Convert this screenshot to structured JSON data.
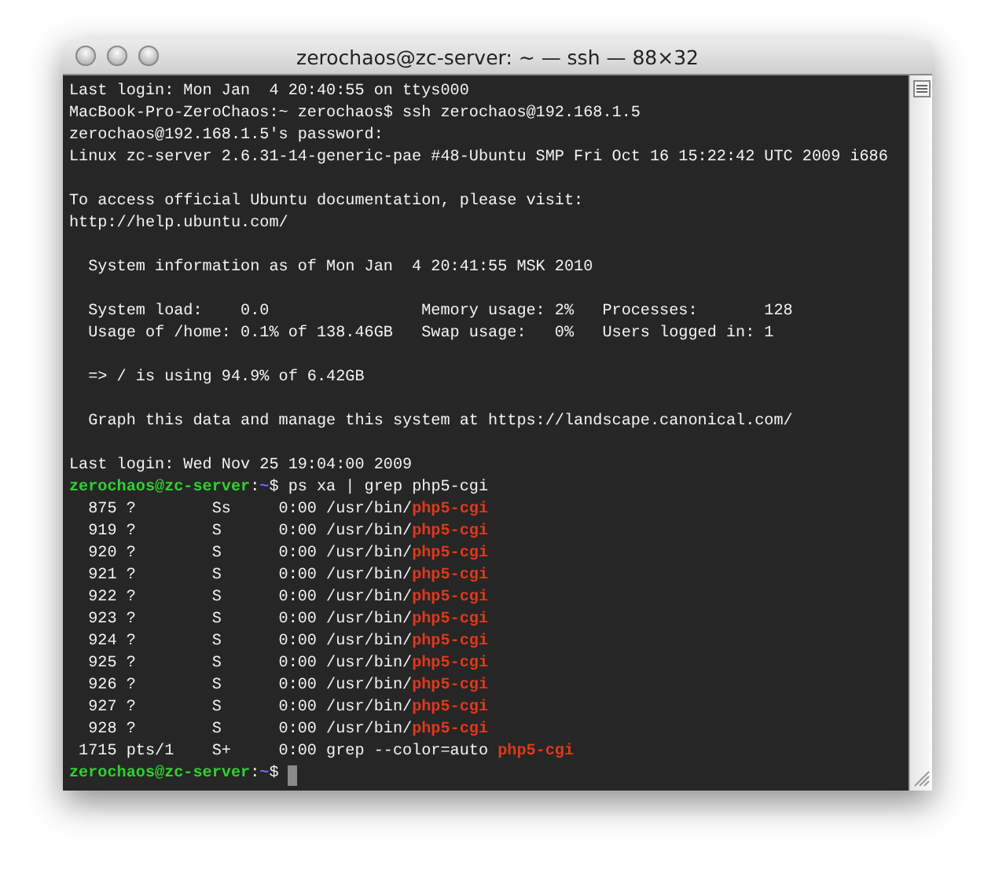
{
  "window": {
    "title": "zerochaos@zc-server: ~ — ssh — 88×32"
  },
  "terminal": {
    "lines": [
      {
        "kind": "text",
        "segments": [
          {
            "kind": "plain",
            "text": "Last login: Mon Jan  4 20:40:55 on ttys000"
          }
        ]
      },
      {
        "kind": "text",
        "segments": [
          {
            "kind": "plain",
            "text": "MacBook-Pro-ZeroChaos:~ zerochaos$ ssh zerochaos@192.168.1.5"
          }
        ]
      },
      {
        "kind": "text",
        "segments": [
          {
            "kind": "plain",
            "text": "zerochaos@192.168.1.5's password:"
          }
        ]
      },
      {
        "kind": "text",
        "segments": [
          {
            "kind": "plain",
            "text": "Linux zc-server 2.6.31-14-generic-pae #48-Ubuntu SMP Fri Oct 16 15:22:42 UTC 2009 i686"
          }
        ]
      },
      {
        "kind": "blank"
      },
      {
        "kind": "text",
        "segments": [
          {
            "kind": "plain",
            "text": "To access official Ubuntu documentation, please visit:"
          }
        ]
      },
      {
        "kind": "text",
        "segments": [
          {
            "kind": "plain",
            "text": "http://help.ubuntu.com/"
          }
        ]
      },
      {
        "kind": "blank"
      },
      {
        "kind": "text",
        "segments": [
          {
            "kind": "plain",
            "text": "  System information as of Mon Jan  4 20:41:55 MSK 2010"
          }
        ]
      },
      {
        "kind": "blank"
      },
      {
        "kind": "text",
        "segments": [
          {
            "kind": "plain",
            "text": "  System load:    0.0                Memory usage: 2%   Processes:       128"
          }
        ]
      },
      {
        "kind": "text",
        "segments": [
          {
            "kind": "plain",
            "text": "  Usage of /home: 0.1% of 138.46GB   Swap usage:   0%   Users logged in: 1"
          }
        ]
      },
      {
        "kind": "blank"
      },
      {
        "kind": "text",
        "segments": [
          {
            "kind": "plain",
            "text": "  => / is using 94.9% of 6.42GB"
          }
        ]
      },
      {
        "kind": "blank"
      },
      {
        "kind": "text",
        "segments": [
          {
            "kind": "plain",
            "text": "  Graph this data and manage this system at https://landscape.canonical.com/"
          }
        ]
      },
      {
        "kind": "blank"
      },
      {
        "kind": "text",
        "segments": [
          {
            "kind": "plain",
            "text": "Last login: Wed Nov 25 19:04:00 2009"
          }
        ]
      },
      {
        "kind": "text",
        "segments": [
          {
            "kind": "user",
            "text": "zerochaos@zc-server"
          },
          {
            "kind": "plain",
            "text": ":"
          },
          {
            "kind": "path",
            "text": "~"
          },
          {
            "kind": "plain",
            "text": "$ ps xa | grep php5-cgi"
          }
        ]
      },
      {
        "kind": "text",
        "segments": [
          {
            "kind": "plain",
            "text": "  875 ?        Ss     0:00 /usr/bin/"
          },
          {
            "kind": "match",
            "text": "php5-cgi"
          }
        ]
      },
      {
        "kind": "text",
        "segments": [
          {
            "kind": "plain",
            "text": "  919 ?        S      0:00 /usr/bin/"
          },
          {
            "kind": "match",
            "text": "php5-cgi"
          }
        ]
      },
      {
        "kind": "text",
        "segments": [
          {
            "kind": "plain",
            "text": "  920 ?        S      0:00 /usr/bin/"
          },
          {
            "kind": "match",
            "text": "php5-cgi"
          }
        ]
      },
      {
        "kind": "text",
        "segments": [
          {
            "kind": "plain",
            "text": "  921 ?        S      0:00 /usr/bin/"
          },
          {
            "kind": "match",
            "text": "php5-cgi"
          }
        ]
      },
      {
        "kind": "text",
        "segments": [
          {
            "kind": "plain",
            "text": "  922 ?        S      0:00 /usr/bin/"
          },
          {
            "kind": "match",
            "text": "php5-cgi"
          }
        ]
      },
      {
        "kind": "text",
        "segments": [
          {
            "kind": "plain",
            "text": "  923 ?        S      0:00 /usr/bin/"
          },
          {
            "kind": "match",
            "text": "php5-cgi"
          }
        ]
      },
      {
        "kind": "text",
        "segments": [
          {
            "kind": "plain",
            "text": "  924 ?        S      0:00 /usr/bin/"
          },
          {
            "kind": "match",
            "text": "php5-cgi"
          }
        ]
      },
      {
        "kind": "text",
        "segments": [
          {
            "kind": "plain",
            "text": "  925 ?        S      0:00 /usr/bin/"
          },
          {
            "kind": "match",
            "text": "php5-cgi"
          }
        ]
      },
      {
        "kind": "text",
        "segments": [
          {
            "kind": "plain",
            "text": "  926 ?        S      0:00 /usr/bin/"
          },
          {
            "kind": "match",
            "text": "php5-cgi"
          }
        ]
      },
      {
        "kind": "text",
        "segments": [
          {
            "kind": "plain",
            "text": "  927 ?        S      0:00 /usr/bin/"
          },
          {
            "kind": "match",
            "text": "php5-cgi"
          }
        ]
      },
      {
        "kind": "text",
        "segments": [
          {
            "kind": "plain",
            "text": "  928 ?        S      0:00 /usr/bin/"
          },
          {
            "kind": "match",
            "text": "php5-cgi"
          }
        ]
      },
      {
        "kind": "text",
        "segments": [
          {
            "kind": "plain",
            "text": " 1715 pts/1    S+     0:00 grep --color=auto "
          },
          {
            "kind": "match",
            "text": "php5-cgi"
          }
        ]
      },
      {
        "kind": "text",
        "cursor": true,
        "segments": [
          {
            "kind": "user",
            "text": "zerochaos@zc-server"
          },
          {
            "kind": "plain",
            "text": ":"
          },
          {
            "kind": "path",
            "text": "~"
          },
          {
            "kind": "plain",
            "text": "$ "
          }
        ]
      }
    ]
  }
}
